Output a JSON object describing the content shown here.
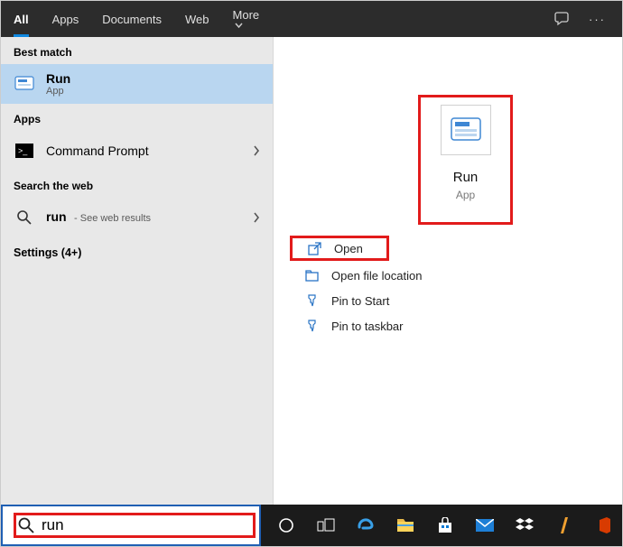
{
  "header": {
    "tabs": {
      "all": "All",
      "apps": "Apps",
      "documents": "Documents",
      "web": "Web",
      "more": "More"
    }
  },
  "left": {
    "best_match_label": "Best match",
    "run": {
      "title": "Run",
      "sub": "App"
    },
    "apps_label": "Apps",
    "cmd": {
      "title": "Command Prompt"
    },
    "search_web_label": "Search the web",
    "web": {
      "title": "run",
      "sub": "- See web results"
    },
    "settings_label": "Settings (4+)"
  },
  "right": {
    "hero": {
      "title": "Run",
      "sub": "App"
    },
    "actions": {
      "open": "Open",
      "openloc": "Open file location",
      "pinstart": "Pin to Start",
      "pintask": "Pin to taskbar"
    }
  },
  "search": {
    "value": "run"
  },
  "taskbar_icons": [
    "cortana",
    "taskview",
    "edge",
    "explorer",
    "store",
    "mail",
    "dropbox",
    "winamp",
    "office"
  ]
}
